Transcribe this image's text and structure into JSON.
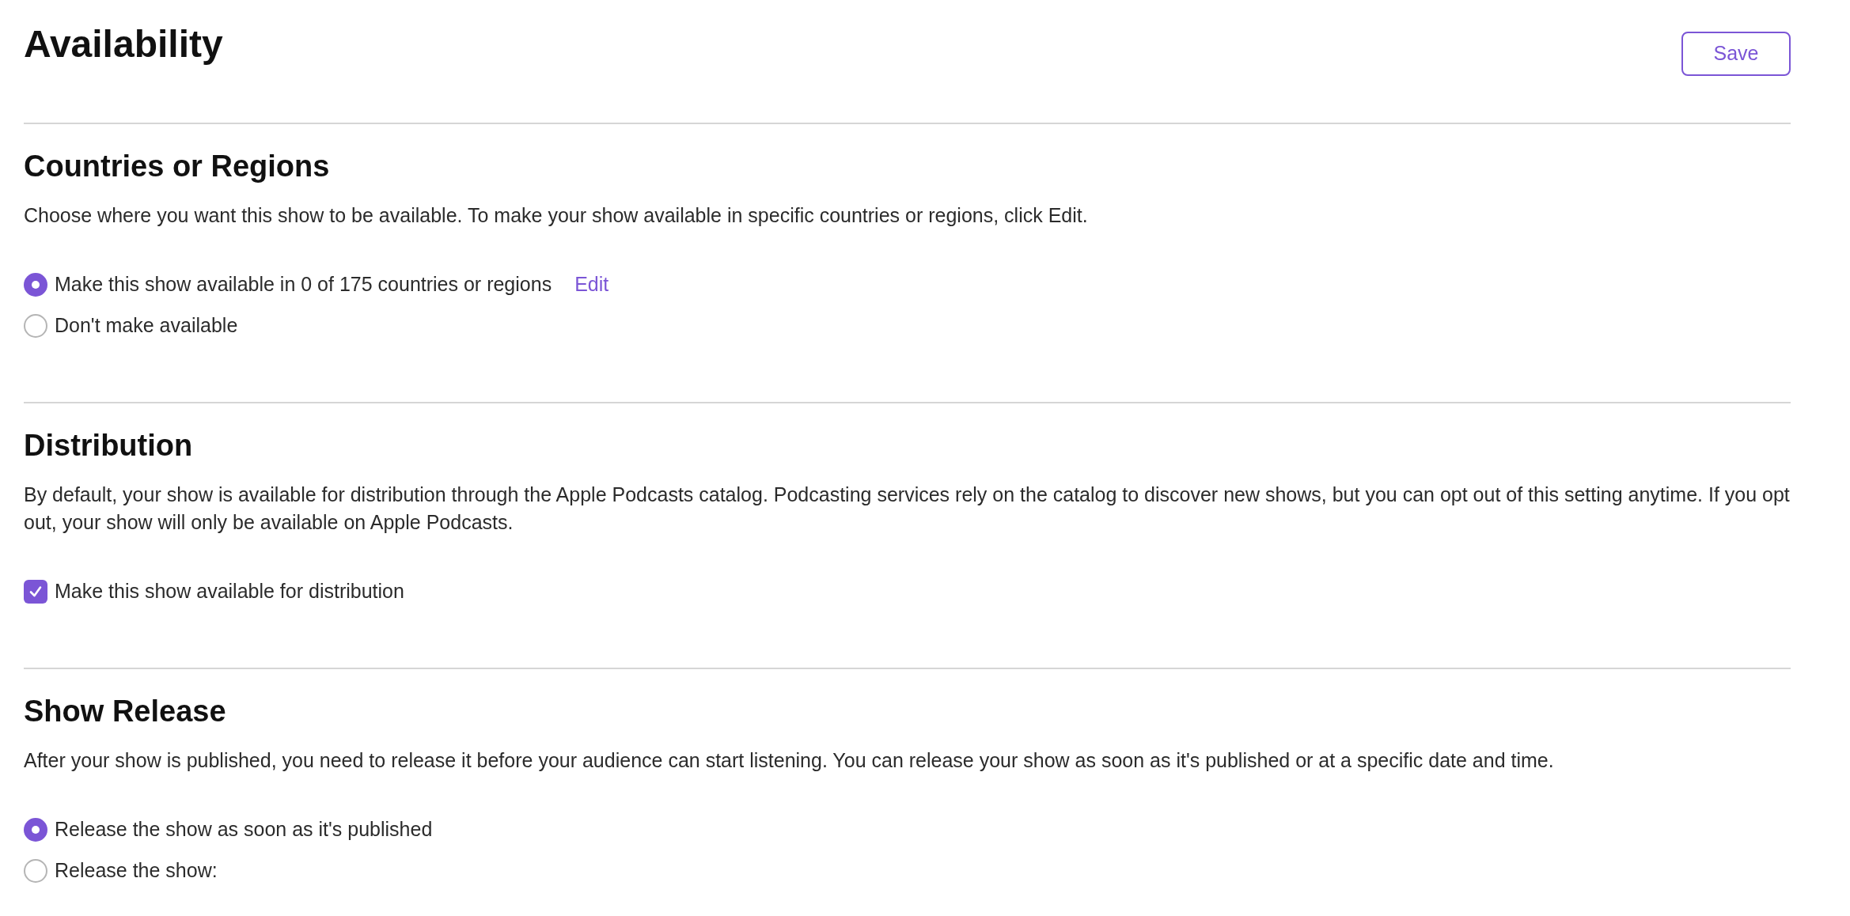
{
  "page": {
    "title": "Availability",
    "save_button": "Save"
  },
  "sections": [
    {
      "title": "Countries or Regions",
      "description": "Choose where you want this show to be available. To make your show available in specific countries or regions, click Edit.",
      "options": [
        {
          "kind": "radio",
          "label": "Make this show available in 0 of 175 countries or regions",
          "selected": true,
          "link": "Edit"
        },
        {
          "kind": "radio",
          "label": "Don't make available",
          "selected": false
        }
      ]
    },
    {
      "title": "Distribution",
      "description": "By default, your show is available for distribution through the Apple Podcasts catalog. Podcasting services rely on the catalog to discover new shows, but you can opt out of this setting anytime. If you opt out, your show will only be available on Apple Podcasts.",
      "options": [
        {
          "kind": "checkbox",
          "label": "Make this show available for distribution",
          "checked": true
        }
      ]
    },
    {
      "title": "Show Release",
      "description": "After your show is published, you need to release it before your audience can start listening. You can release your show as soon as it's published or at a specific date and time.",
      "options": [
        {
          "kind": "radio",
          "label": "Release the show as soon as it's published",
          "selected": true
        },
        {
          "kind": "radio",
          "label": "Release the show:",
          "selected": false
        }
      ]
    }
  ]
}
